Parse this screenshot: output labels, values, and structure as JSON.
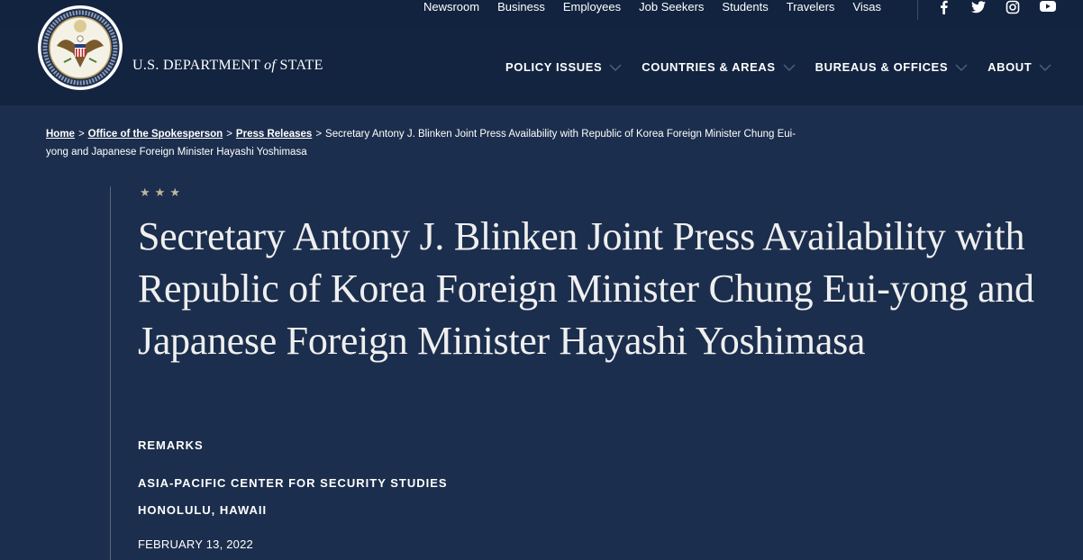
{
  "utility_nav": [
    "Newsroom",
    "Business",
    "Employees",
    "Job Seekers",
    "Students",
    "Travelers",
    "Visas"
  ],
  "social_icons": [
    "facebook-icon",
    "twitter-icon",
    "instagram-icon",
    "youtube-icon"
  ],
  "brand": {
    "prefix": "U.S. DEPARTMENT",
    "of": "of",
    "suffix": "STATE"
  },
  "main_nav": [
    {
      "label": "POLICY ISSUES"
    },
    {
      "label": "COUNTRIES & AREAS"
    },
    {
      "label": "BUREAUS & OFFICES"
    },
    {
      "label": "ABOUT"
    }
  ],
  "breadcrumb": {
    "home": "Home",
    "office": "Office of the Spokesperson",
    "press": "Press Releases",
    "current": "Secretary Antony J. Blinken Joint Press Availability with Republic of Korea Foreign Minister Chung Eui-yong and Japanese Foreign Minister Hayashi Yoshimasa",
    "separator": ">"
  },
  "article": {
    "title": "Secretary Antony J. Blinken Joint Press Availability with Republic of Korea Foreign Minister Chung Eui-yong and Japanese Foreign Minister Hayashi Yoshimasa",
    "type": "REMARKS",
    "location_1": "ASIA-PACIFIC CENTER FOR SECURITY STUDIES",
    "location_2": "HONOLULU, HAWAII",
    "date": "FEBRUARY 13, 2022"
  },
  "colors": {
    "header_bg": "#132440",
    "content_bg": "#1c2e4d",
    "star": "#c0b6a1"
  }
}
